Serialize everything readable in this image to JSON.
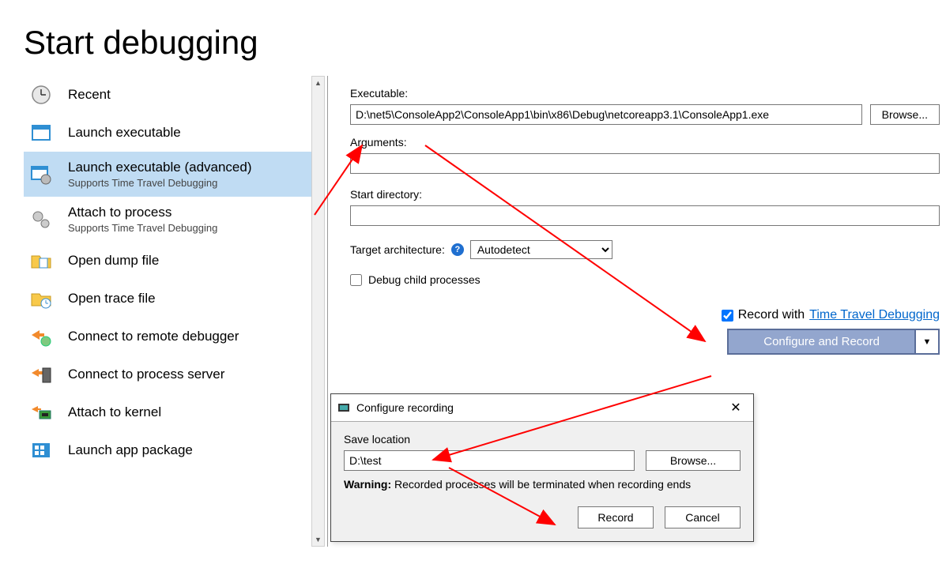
{
  "title": "Start debugging",
  "sidebar": {
    "items": [
      {
        "label": "Recent",
        "sub": ""
      },
      {
        "label": "Launch executable",
        "sub": ""
      },
      {
        "label": "Launch executable (advanced)",
        "sub": "Supports Time Travel Debugging"
      },
      {
        "label": "Attach to process",
        "sub": "Supports Time Travel Debugging"
      },
      {
        "label": "Open dump file",
        "sub": ""
      },
      {
        "label": "Open trace file",
        "sub": ""
      },
      {
        "label": "Connect to remote debugger",
        "sub": ""
      },
      {
        "label": "Connect to process server",
        "sub": ""
      },
      {
        "label": "Attach to kernel",
        "sub": ""
      },
      {
        "label": "Launch app package",
        "sub": ""
      }
    ],
    "selectedIndex": 2
  },
  "form": {
    "executable_label": "Executable:",
    "executable_value": "D:\\net5\\ConsoleApp2\\ConsoleApp1\\bin\\x86\\Debug\\netcoreapp3.1\\ConsoleApp1.exe",
    "arguments_label": "Arguments:",
    "arguments_value": "",
    "startdir_label": "Start directory:",
    "startdir_value": "",
    "arch_label": "Target architecture:",
    "arch_value": "Autodetect",
    "browse_label": "Browse...",
    "debug_child_label": "Debug child processes",
    "debug_child_checked": false,
    "record_checked": true,
    "record_label_prefix": "Record with ",
    "record_link": "Time Travel Debugging",
    "configure_label": "Configure and Record"
  },
  "dialog": {
    "title": "Configure recording",
    "save_label": "Save location",
    "save_value": "D:\\test",
    "browse_label": "Browse...",
    "warning_prefix": "Warning:",
    "warning_text": " Recorded processes will be terminated when recording ends",
    "record_btn": "Record",
    "cancel_btn": "Cancel"
  },
  "annotation_color": "#ff0000"
}
